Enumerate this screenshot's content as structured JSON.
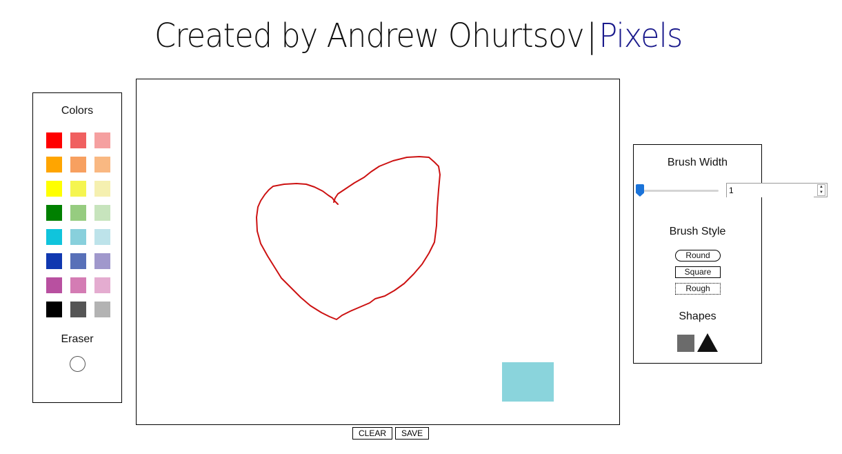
{
  "header": {
    "title_prefix": "Created by Andrew Ohurtsov",
    "separator": "|",
    "brand": "Pixels",
    "brand_color": "#1a1a8c"
  },
  "colors_panel": {
    "heading": "Colors",
    "swatches": [
      "#ff0000",
      "#f06060",
      "#f5a0a0",
      "#ffa500",
      "#f7a060",
      "#f9b882",
      "#ffff00",
      "#f5f550",
      "#f5f0b0",
      "#008000",
      "#96cc80",
      "#c7e4bd",
      "#10c4dc",
      "#88d0dc",
      "#bde3ea",
      "#1038b0",
      "#5870b8",
      "#a098cc",
      "#b850a0",
      "#d47cb4",
      "#e4acd0",
      "#000000",
      "#555555",
      "#b3b3b3"
    ],
    "eraser_label": "Eraser"
  },
  "canvas": {
    "stroke_color": "#cc1111",
    "rect_color": "#8ad4dc"
  },
  "actions": {
    "clear_label": "CLEAR",
    "save_label": "SAVE"
  },
  "brush_panel": {
    "width_heading": "Brush Width",
    "width_value": "1",
    "style_heading": "Brush Style",
    "styles": [
      "Round",
      "Square",
      "Rough"
    ],
    "shapes_heading": "Shapes",
    "slider_color": "#1a73d9"
  }
}
